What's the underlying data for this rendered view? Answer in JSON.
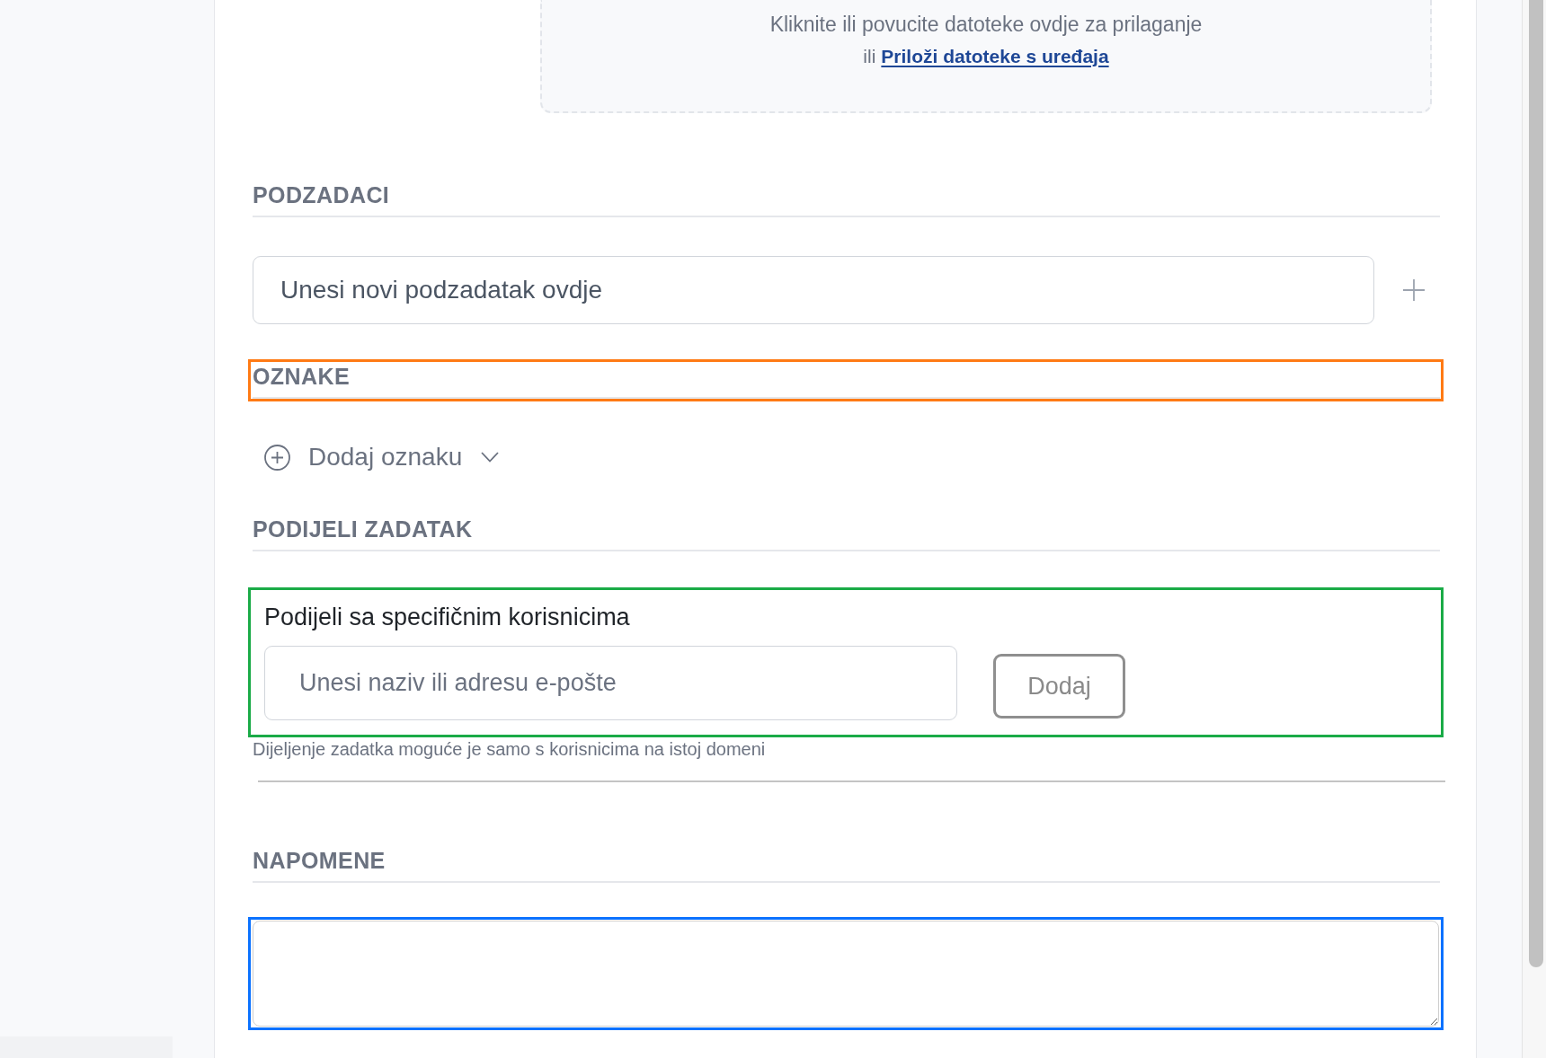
{
  "dropzone": {
    "prompt": "Kliknite ili povucite datoteke ovdje za prilaganje",
    "alternative": "ili",
    "link": "Priloži datoteke s uređaja"
  },
  "sections": [
    {
      "kind": "subtasks",
      "heading": "PODZADACI",
      "input": {
        "placeholder": "Unesi novi podzadatak ovdje"
      }
    },
    {
      "kind": "tags",
      "heading": "OZNAKE",
      "highlight": {
        "color": "#ff7a14"
      },
      "add_button": "Dodaj oznaku"
    },
    {
      "kind": "share",
      "heading": "PODIJELI ZADATAK",
      "highlight": {
        "color": "#1aab47"
      },
      "label": "Podijeli sa specifičnim korisnicima",
      "input": {
        "placeholder": "Unesi naziv ili adresu e-pošte"
      },
      "button": {
        "label": "Dodaj",
        "disabled": true
      },
      "hint": "Dijeljenje zadatka moguće je samo s korisnicima na istoj domeni"
    },
    {
      "kind": "notes",
      "heading": "NAPOMENE",
      "highlight": {
        "color": "#0b72ff"
      }
    }
  ]
}
